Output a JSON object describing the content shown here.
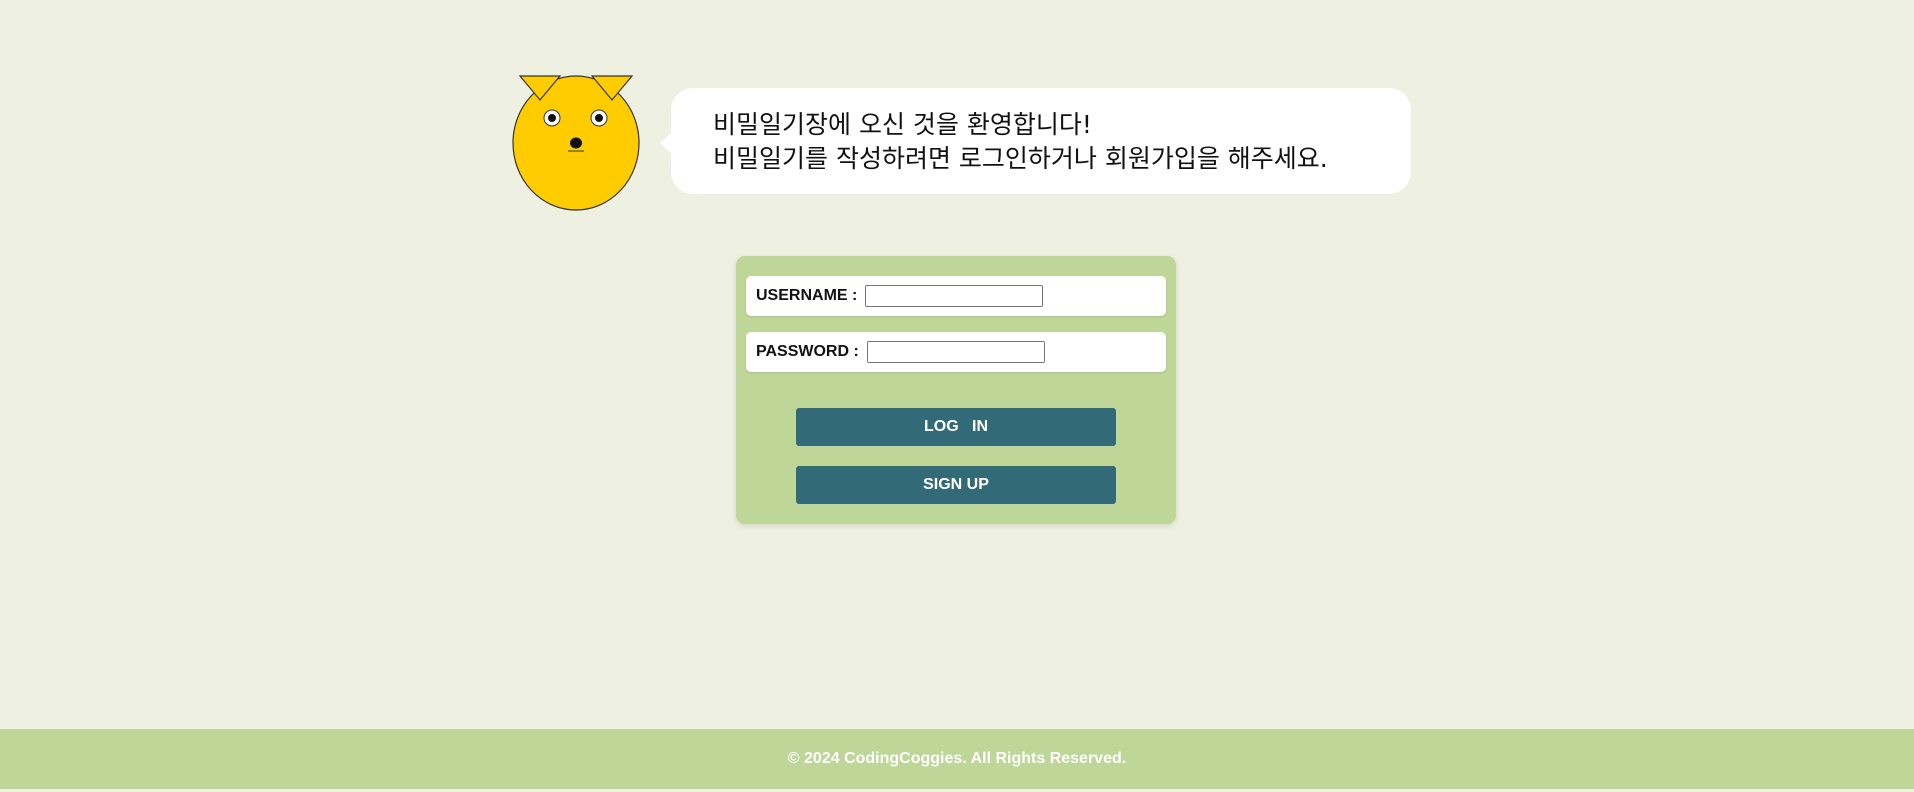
{
  "colors": {
    "background": "#eef1e1",
    "panel": "#bed698",
    "button": "#336a78",
    "mascot": "#ffcc00"
  },
  "mascot": {
    "icon": "cat-face-icon"
  },
  "greeting": {
    "line1": "비밀일기장에 오신 것을 환영합니다!",
    "line2": "비밀일기를 작성하려면 로그인하거나 회원가입을 해주세요."
  },
  "login_form": {
    "username_label": "USERNAME :",
    "username_value": "",
    "password_label": "PASSWORD :",
    "password_value": "",
    "login_button": "LOG   IN",
    "signup_button": "SIGN UP"
  },
  "footer": {
    "text": "© 2024 CodingCoggies. All Rights Reserved."
  }
}
